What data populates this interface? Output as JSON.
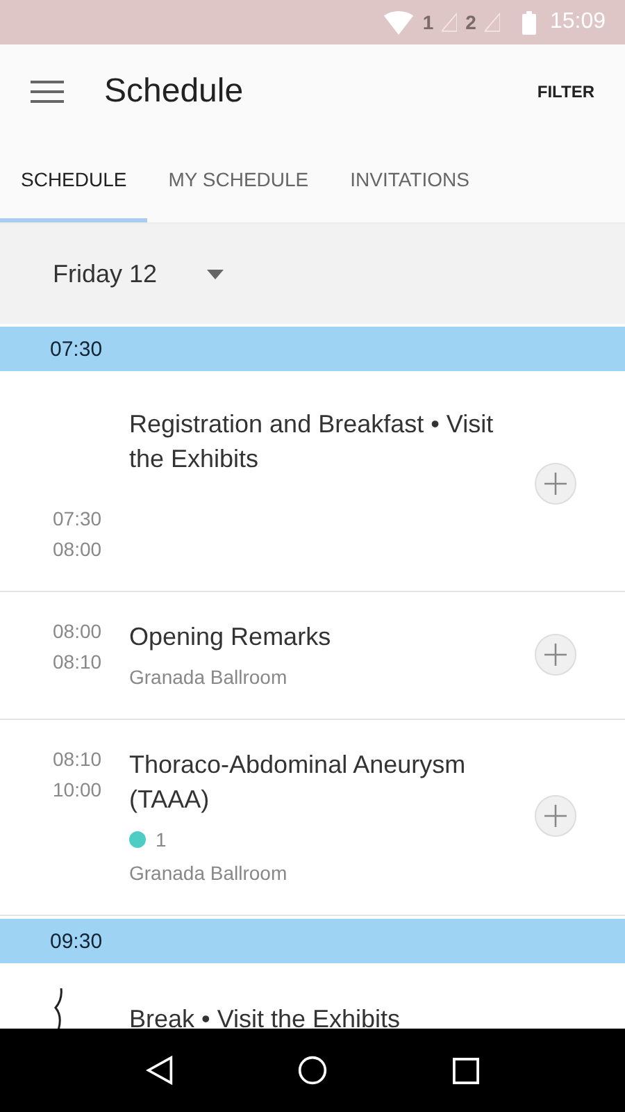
{
  "status_bar": {
    "sim_1": "1",
    "sim_2": "2",
    "time": "15:09"
  },
  "app_bar": {
    "title": "Schedule",
    "action": "FILTER"
  },
  "tabs": [
    {
      "label": "SCHEDULE",
      "selected": true
    },
    {
      "label": "MY SCHEDULE",
      "selected": false
    },
    {
      "label": "INVITATIONS",
      "selected": false
    }
  ],
  "day_picker": {
    "value": "Friday 12"
  },
  "timeline": [
    {
      "kind": "time",
      "label": "07:30"
    },
    {
      "kind": "session",
      "start": "07:30",
      "end": "08:00",
      "title": "Registration and Breakfast • Visit the Exhibits"
    },
    {
      "kind": "session",
      "start": "08:00",
      "end": "08:10",
      "title": "Opening Remarks",
      "location": "Granada Ballroom"
    },
    {
      "kind": "session",
      "start": "08:10",
      "end": "10:00",
      "title": "Thoraco-Abdominal Aneurysm (TAAA)",
      "badge": {
        "count": "1",
        "color": "#4ecdc4"
      },
      "location": "Granada Ballroom"
    },
    {
      "kind": "time",
      "label": "09:30"
    },
    {
      "kind": "break",
      "title": "Break • Visit the Exhibits"
    }
  ]
}
